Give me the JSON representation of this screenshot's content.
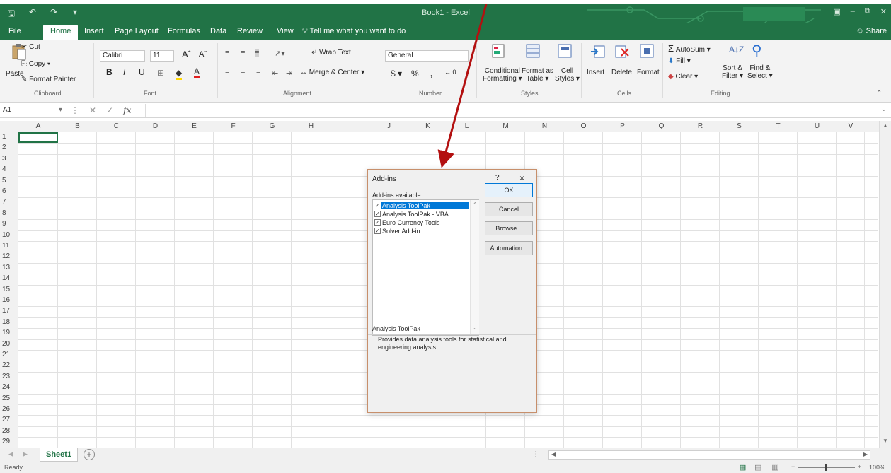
{
  "window": {
    "title": "Book1 - Excel",
    "account_name": "",
    "share_label": "Share"
  },
  "tabs": [
    {
      "label": "File"
    },
    {
      "label": "Home",
      "active": true
    },
    {
      "label": "Insert"
    },
    {
      "label": "Page Layout"
    },
    {
      "label": "Formulas"
    },
    {
      "label": "Data"
    },
    {
      "label": "Review"
    },
    {
      "label": "View"
    }
  ],
  "tell_me": "Tell me what you want to do",
  "ribbon": {
    "clipboard": {
      "paste": "Paste",
      "cut": "Cut",
      "copy": "Copy",
      "format_painter": "Format Painter",
      "group": "Clipboard"
    },
    "font": {
      "name": "Calibri",
      "size": "11",
      "group": "Font"
    },
    "alignment": {
      "wrap_text": "Wrap Text",
      "merge_center": "Merge & Center",
      "group": "Alignment"
    },
    "number": {
      "format": "General",
      "group": "Number"
    },
    "styles": {
      "conditional": "Conditional",
      "formatting": "Formatting",
      "format_as": "Format as",
      "table": "Table",
      "cell": "Cell",
      "styles": "Styles",
      "group": "Styles"
    },
    "cells": {
      "insert": "Insert",
      "delete": "Delete",
      "format": "Format",
      "group": "Cells"
    },
    "editing": {
      "autosum": "AutoSum",
      "fill": "Fill",
      "clear": "Clear",
      "sort": "Sort &",
      "filter": "Filter",
      "find": "Find &",
      "select": "Select",
      "group": "Editing"
    }
  },
  "formula_bar": {
    "name_box": "A1",
    "fx": "fx"
  },
  "columns": [
    "A",
    "B",
    "C",
    "D",
    "E",
    "F",
    "G",
    "H",
    "I",
    "J",
    "K",
    "L",
    "M",
    "N",
    "O",
    "P",
    "Q",
    "R",
    "S",
    "T",
    "U",
    "V"
  ],
  "rows": [
    "1",
    "2",
    "3",
    "4",
    "5",
    "6",
    "7",
    "8",
    "9",
    "10",
    "11",
    "12",
    "13",
    "14",
    "15",
    "16",
    "17",
    "18",
    "19",
    "20",
    "21",
    "22",
    "23",
    "24",
    "25",
    "26",
    "27",
    "28",
    "29"
  ],
  "sheet": {
    "tab": "Sheet1"
  },
  "status": {
    "mode": "Ready",
    "zoom": "100%"
  },
  "dialog": {
    "title": "Add-ins",
    "help": "?",
    "close": "×",
    "available_label": "Add-ins available:",
    "items": [
      {
        "label": "Analysis ToolPak",
        "checked": true,
        "selected": true
      },
      {
        "label": "Analysis ToolPak - VBA",
        "checked": true,
        "selected": false
      },
      {
        "label": "Euro Currency Tools",
        "checked": true,
        "selected": false
      },
      {
        "label": "Solver Add-in",
        "checked": true,
        "selected": false
      }
    ],
    "buttons": {
      "ok": "OK",
      "cancel": "Cancel",
      "browse": "Browse...",
      "automation": "Automation..."
    },
    "description_title": "Analysis ToolPak",
    "description": "Provides data analysis tools for statistical and engineering analysis"
  },
  "colors": {
    "excel_green": "#217346",
    "annotation_arrow": "#b31010",
    "selection_blue": "#0078d7"
  }
}
